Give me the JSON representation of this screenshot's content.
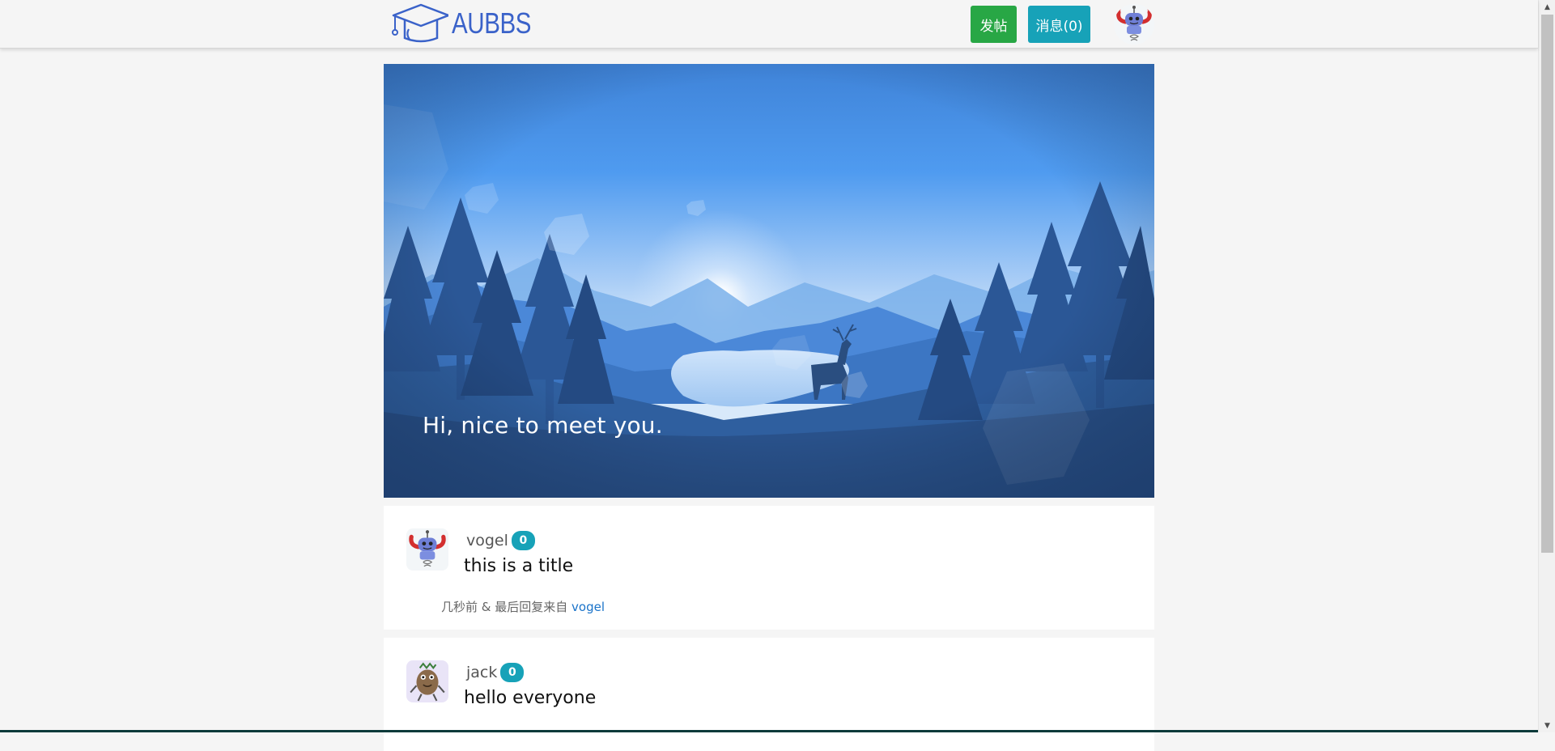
{
  "header": {
    "logo_text": "AUBBS",
    "post_button": "发帖",
    "messages_button": "消息(0)"
  },
  "banner": {
    "caption": "Hi, nice to meet you."
  },
  "posts": [
    {
      "author": "vogel",
      "badge": "0",
      "title": "this is a title",
      "meta_prefix": "几秒前 & 最后回复来自",
      "last_reply_user": "vogel"
    },
    {
      "author": "jack",
      "badge": "0",
      "title": "hello everyone"
    }
  ],
  "colors": {
    "post_button": "#28a745",
    "messages_button": "#17a2b8",
    "logo": "#3a62c9",
    "link": "#1a73c9"
  }
}
